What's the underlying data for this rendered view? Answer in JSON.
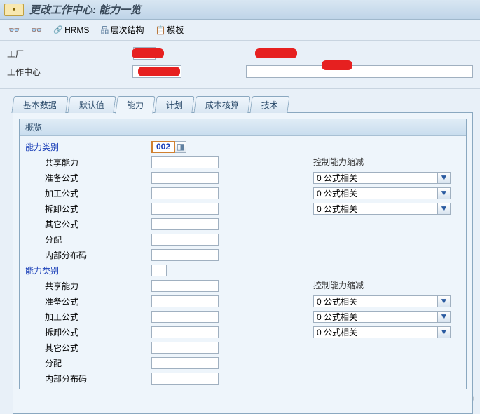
{
  "titlebar": {
    "title": "更改工作中心: 能力一览"
  },
  "toolbar": {
    "hrms": "HRMS",
    "hierarchy": "层次结构",
    "template": "模板"
  },
  "header": {
    "plant_label": "工厂",
    "workcenter_label": "工作中心"
  },
  "tabs": {
    "items": [
      {
        "label": "基本数据"
      },
      {
        "label": "默认值"
      },
      {
        "label": "能力"
      },
      {
        "label": "计划"
      },
      {
        "label": "成本核算"
      },
      {
        "label": "技术"
      }
    ],
    "active_index": 2
  },
  "group": {
    "overview_label": "概览",
    "section1": {
      "category_label": "能力类别",
      "category_value": "002",
      "pooled_label": "共享能力",
      "setup_label": "准备公式",
      "process_label": "加工公式",
      "teardown_label": "拆卸公式",
      "other_label": "其它公式",
      "distribution_label": "分配",
      "int_dist_label": "内部分布码",
      "control_label": "控制能力缩减",
      "dd_value": "0 公式相关"
    },
    "section2": {
      "category_label": "能力类别",
      "pooled_label": "共享能力",
      "setup_label": "准备公式",
      "process_label": "加工公式",
      "teardown_label": "拆卸公式",
      "other_label": "其它公式",
      "distribution_label": "分配",
      "int_dist_label": "内部分布码",
      "control_label": "控制能力缩减",
      "dd_value": "0 公式相关"
    }
  },
  "watermark": "https://blog.csdn.net/zhongguomao"
}
